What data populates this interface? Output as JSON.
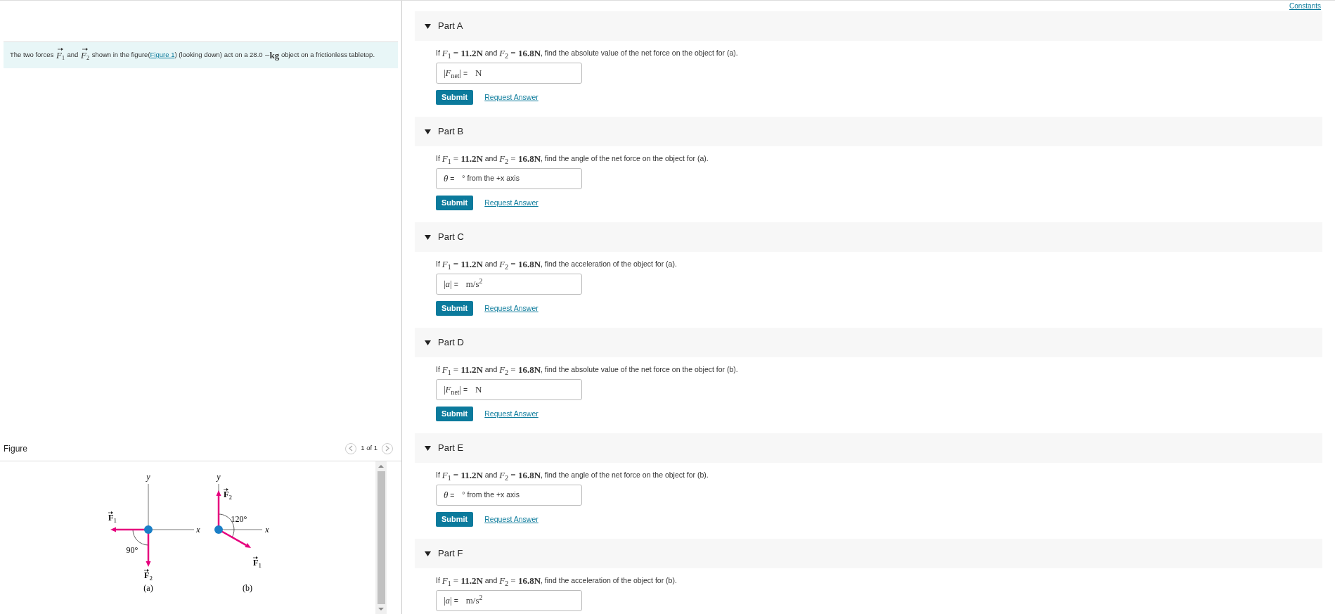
{
  "constants_link": "Constants",
  "intro": [
    {
      "kind": "text",
      "text": "The two forces "
    },
    {
      "kind": "vector",
      "symbol": "F",
      "index": "1"
    },
    {
      "kind": "text",
      "text": " and "
    },
    {
      "kind": "vector",
      "symbol": "F",
      "index": "2"
    },
    {
      "kind": "text",
      "text": " shown in the figure("
    },
    {
      "kind": "link",
      "text": "Figure 1"
    },
    {
      "kind": "text",
      "text": ") (looking down) act on a 28.0 "
    },
    {
      "kind": "math",
      "text": "−**kg**"
    },
    {
      "kind": "text",
      "text": " object on a frictionless tabletop."
    }
  ],
  "figure": {
    "title": "Figure",
    "pager": "1 of 1",
    "diagrams": [
      {
        "kind": "a",
        "x_axis": "x",
        "y_axis": "y",
        "f1": {
          "symbol": "F",
          "index": "1"
        },
        "f2": {
          "symbol": "F",
          "index": "2"
        },
        "angle": "90°",
        "caption": "(a)"
      },
      {
        "kind": "b",
        "x_axis": "x",
        "y_axis": "y",
        "f1": {
          "symbol": "F",
          "index": "1"
        },
        "f2": {
          "symbol": "F",
          "index": "2"
        },
        "angle": "120°",
        "caption": "(b)"
      }
    ]
  },
  "parts": [
    {
      "title": "Part A",
      "expanded": true,
      "question": [
        {
          "kind": "text",
          "text": "If "
        },
        {
          "kind": "math",
          "text": "*F*$_{1}$ = **11.2N**"
        },
        {
          "kind": "text",
          "text": " and "
        },
        {
          "kind": "math",
          "text": "*F*$_{2}$ = **16.8N**"
        },
        {
          "kind": "text",
          "text": ", find the absolute value of the net force on the object for (a)."
        }
      ],
      "answer_label": [
        {
          "kind": "math",
          "text": "|*F*$_{net}$|"
        },
        {
          "kind": "text",
          "text": " = "
        }
      ],
      "answer_unit": [
        {
          "kind": "math",
          "text": "N"
        }
      ],
      "submit": "Submit",
      "request": "Request Answer"
    },
    {
      "title": "Part B",
      "expanded": true,
      "question": [
        {
          "kind": "text",
          "text": "If "
        },
        {
          "kind": "math",
          "text": "*F*$_{1}$ = **11.2N**"
        },
        {
          "kind": "text",
          "text": " and "
        },
        {
          "kind": "math",
          "text": "*F*$_{2}$ = **16.8N**"
        },
        {
          "kind": "text",
          "text": ", find the angle of the net force on the object for (a)."
        }
      ],
      "answer_label": [
        {
          "kind": "math",
          "text": "*θ*"
        },
        {
          "kind": "text",
          "text": " = "
        }
      ],
      "answer_unit": [
        {
          "kind": "text",
          "text": "° from the +x axis"
        }
      ],
      "submit": "Submit",
      "request": "Request Answer"
    },
    {
      "title": "Part C",
      "expanded": true,
      "question": [
        {
          "kind": "text",
          "text": "If "
        },
        {
          "kind": "math",
          "text": "*F*$_{1}$ = **11.2N**"
        },
        {
          "kind": "text",
          "text": " and "
        },
        {
          "kind": "math",
          "text": "*F*$_{2}$ = **16.8N**"
        },
        {
          "kind": "text",
          "text": ", find the acceleration of the object for (a)."
        }
      ],
      "answer_label": [
        {
          "kind": "math",
          "text": "|*a*|"
        },
        {
          "kind": "text",
          "text": " = "
        }
      ],
      "answer_unit": [
        {
          "kind": "math",
          "text": "m/s$^{2}$"
        }
      ],
      "submit": "Submit",
      "request": "Request Answer"
    },
    {
      "title": "Part D",
      "expanded": true,
      "question": [
        {
          "kind": "text",
          "text": "If "
        },
        {
          "kind": "math",
          "text": "*F*$_{1}$ = **11.2N**"
        },
        {
          "kind": "text",
          "text": " and "
        },
        {
          "kind": "math",
          "text": "*F*$_{2}$ = **16.8N**"
        },
        {
          "kind": "text",
          "text": ", find the absolute value of the net force on the object for (b)."
        }
      ],
      "answer_label": [
        {
          "kind": "math",
          "text": "|*F*$_{net}$|"
        },
        {
          "kind": "text",
          "text": " = "
        }
      ],
      "answer_unit": [
        {
          "kind": "math",
          "text": "N"
        }
      ],
      "submit": "Submit",
      "request": "Request Answer"
    },
    {
      "title": "Part E",
      "expanded": true,
      "question": [
        {
          "kind": "text",
          "text": "If "
        },
        {
          "kind": "math",
          "text": "*F*$_{1}$ = **11.2N**"
        },
        {
          "kind": "text",
          "text": " and "
        },
        {
          "kind": "math",
          "text": "*F*$_{2}$ = **16.8N**"
        },
        {
          "kind": "text",
          "text": ", find the angle of the net force on the object for (b)."
        }
      ],
      "answer_label": [
        {
          "kind": "math",
          "text": "*θ*"
        },
        {
          "kind": "text",
          "text": " = "
        }
      ],
      "answer_unit": [
        {
          "kind": "text",
          "text": "° from the +x axis"
        }
      ],
      "submit": "Submit",
      "request": "Request Answer"
    },
    {
      "title": "Part F",
      "expanded": true,
      "question": [
        {
          "kind": "text",
          "text": "If "
        },
        {
          "kind": "math",
          "text": "*F*$_{1}$ = **11.2N**"
        },
        {
          "kind": "text",
          "text": " and "
        },
        {
          "kind": "math",
          "text": "*F*$_{2}$ = **16.8N**"
        },
        {
          "kind": "text",
          "text": ", find the acceleration of the object for (b)."
        }
      ],
      "answer_label": [
        {
          "kind": "math",
          "text": "|*a*|"
        },
        {
          "kind": "text",
          "text": " = "
        }
      ],
      "answer_unit": [
        {
          "kind": "math",
          "text": "m/s$^{2}$"
        }
      ]
    }
  ]
}
